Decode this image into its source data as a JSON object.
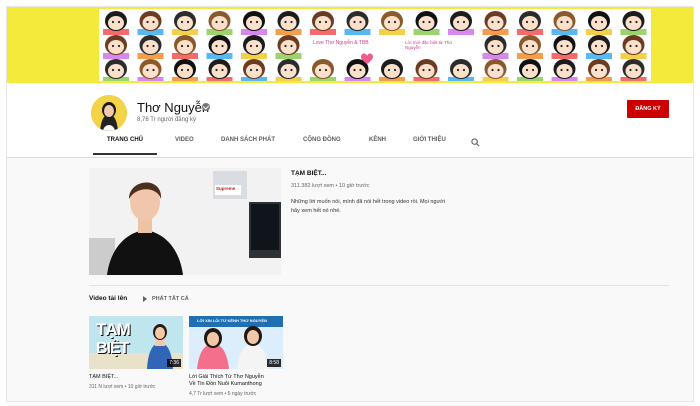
{
  "channel": {
    "name": "Thơ Nguyễn",
    "subscribers": "8,76 Tr người đăng ký",
    "subscribe_label": "ĐĂNG KÝ",
    "banner_text_1": "Love Thơ Nguyễn & TBB",
    "banner_text_2": "Lời mời đặc biệt từ Thơ Nguyễn"
  },
  "tabs": [
    {
      "label": "TRANG CHỦ",
      "active": true
    },
    {
      "label": "VIDEO"
    },
    {
      "label": "DANH SÁCH PHÁT"
    },
    {
      "label": "CỘNG ĐỒNG"
    },
    {
      "label": "KÊNH"
    },
    {
      "label": "GIỚI THIỆU"
    }
  ],
  "featured": {
    "title": "TẠM BIỆT...",
    "meta": "311.382 lượt xem • 10 giờ trước",
    "description_1": "Những lời muốn nói, mình đã nói hết trong video rồi. Mọi người",
    "description_2": "hãy xem hết nó nhé.",
    "thumb_sign": "Supreme"
  },
  "uploads": {
    "section_title": "Video tải lên",
    "play_all": "PHÁT TẤT CẢ",
    "videos": [
      {
        "thumb_text_1": "TẠM",
        "thumb_text_2": "BIỆT",
        "duration": "7:36",
        "title_1": "TẠM BIỆT...",
        "title_2": "",
        "meta": "311 N lượt xem • 10 giờ trước"
      },
      {
        "thumb_banner": "LỜI XIN LỖI TỪ KÊNH THƠ NGUYỄN",
        "duration": "8:58",
        "title_1": "Lời Giải Thích Từ Thơ Nguyễn",
        "title_2": "Về Tin Đồn Nuôi Kumanthong",
        "meta": "4,7 Tr lượt xem • 5 ngày trước"
      }
    ]
  },
  "colors": {
    "banner_yellow": "#f4ea3c",
    "subscribe_red": "#cc0000",
    "tab_active": "#111111"
  },
  "icons": [
    "search-icon",
    "verified-icon",
    "play-icon"
  ]
}
